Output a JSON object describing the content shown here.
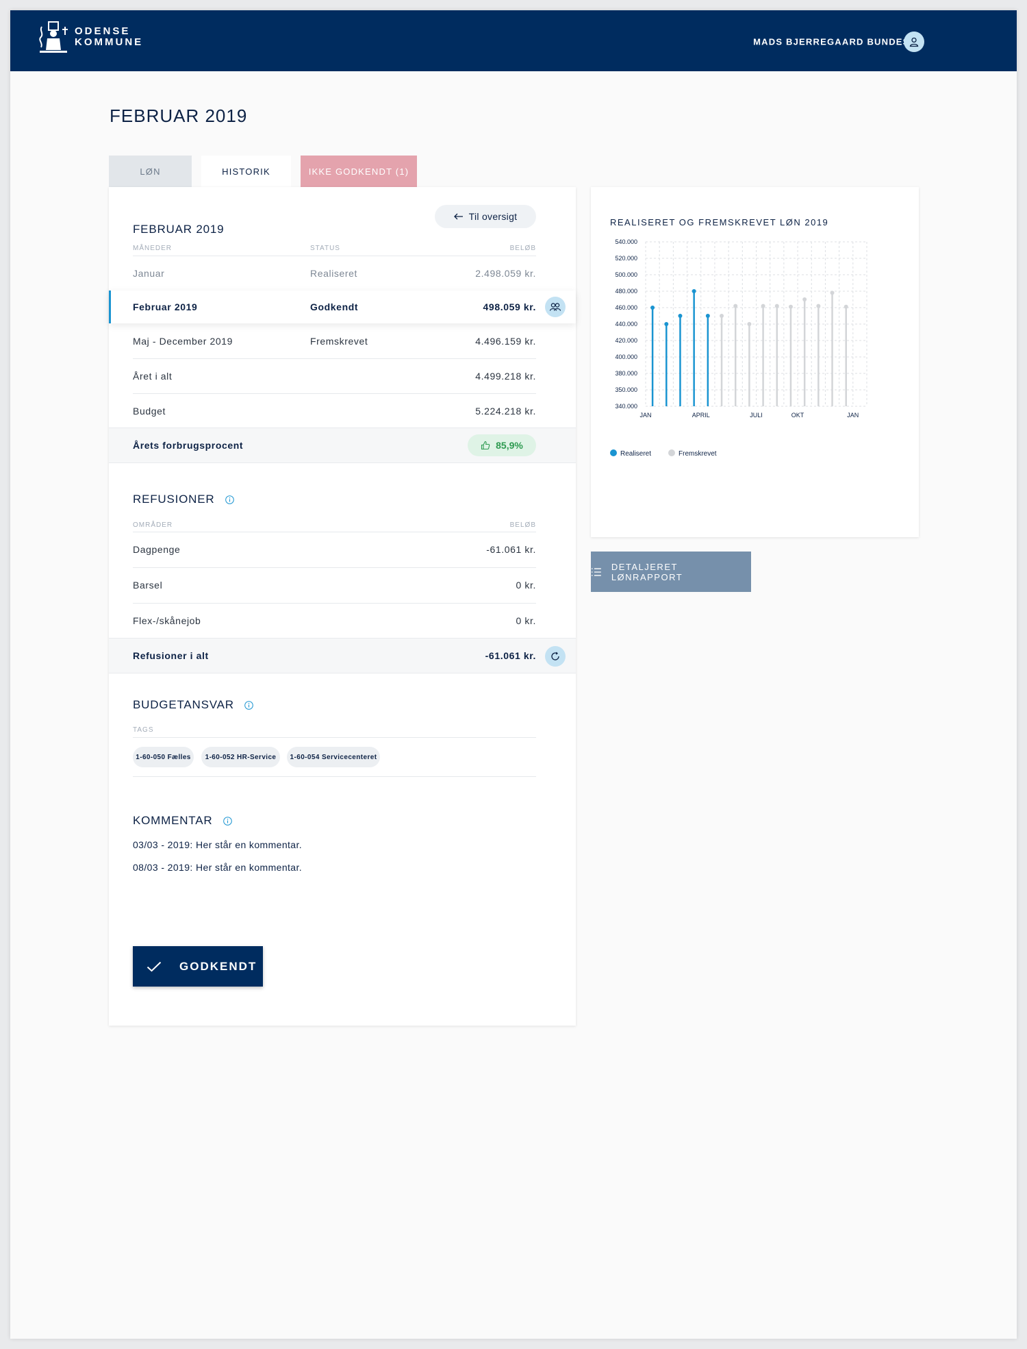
{
  "header": {
    "logo_line1": "ODENSE",
    "logo_line2": "KOMMUNE",
    "user_name": "MADS BJERREGAARD BUNDESEN"
  },
  "page_title": "FEBRUAR 2019",
  "tabs": [
    {
      "label": "LØN"
    },
    {
      "label": "HISTORIK",
      "active": true
    },
    {
      "label": "IKKE GODKENDT (1)"
    }
  ],
  "overview": {
    "title": "FEBRUAR 2019",
    "back_label": "Til oversigt",
    "col_months": "MÅNEDER",
    "col_status": "STATUS",
    "col_amount": "BELØB",
    "rows": [
      {
        "month": "Januar",
        "status": "Realiseret",
        "amount": "2.498.059 kr."
      },
      {
        "month": "Februar 2019",
        "status": "Godkendt",
        "amount": "498.059 kr."
      },
      {
        "month": "Maj - December 2019",
        "status": "Fremskrevet",
        "amount": "4.496.159 kr."
      },
      {
        "month": "Året i alt",
        "status": "",
        "amount": "4.499.218 kr."
      },
      {
        "month": "Budget",
        "status": "",
        "amount": "5.224.218 kr."
      }
    ],
    "usage_label": "Årets forbrugsprocent",
    "usage_value": "85,9%"
  },
  "refusioner": {
    "title": "REFUSIONER",
    "col_areas": "OMRÅDER",
    "col_amount": "BELØB",
    "rows": [
      {
        "label": "Dagpenge",
        "amount": "-61.061 kr."
      },
      {
        "label": "Barsel",
        "amount": "0 kr."
      },
      {
        "label": "Flex-/skånejob",
        "amount": "0 kr."
      }
    ],
    "total_label": "Refusioner i alt",
    "total_amount": "-61.061 kr."
  },
  "budget": {
    "title": "BUDGETANSVAR",
    "col_tags": "TAGS",
    "tags": [
      "1-60-050 Fælles",
      "1-60-052 HR-Service",
      "1-60-054 Servicecenteret"
    ]
  },
  "comments": {
    "title": "KOMMENTAR",
    "items": [
      "03/03 - 2019: Her står en kommentar.",
      "08/03 - 2019: Her står en kommentar."
    ]
  },
  "approve_label": "GODKENDT",
  "report_label": "DETALJERET LØNRAPPORT",
  "colors": {
    "navy": "#002c5f",
    "realiseret": "#1a94d1",
    "fremskrevet": "#d3d5d8",
    "tab_alert": "#e4a3ad",
    "usage_green": "#2d9a50"
  },
  "chart_data": {
    "type": "bar",
    "title": "REALISERET OG FREMSKREVET LØN 2019",
    "y_ticks": [
      "540.000",
      "520.000",
      "500.000",
      "480.000",
      "460.000",
      "440.000",
      "420.000",
      "400.000",
      "380.000",
      "350.000",
      "340.000"
    ],
    "x_tick_labels": [
      "JAN",
      "APRIL",
      "JULI",
      "OKT",
      "JAN"
    ],
    "series": [
      {
        "name": "Realiseret",
        "values": [
          460000,
          440000,
          450000,
          480000,
          450000,
          null,
          null,
          null,
          null,
          null,
          null,
          null,
          null,
          null,
          null
        ]
      },
      {
        "name": "Fremskrevet",
        "values": [
          null,
          null,
          null,
          null,
          null,
          450000,
          462000,
          440000,
          462000,
          462000,
          461000,
          470000,
          462000,
          478000,
          461000
        ]
      }
    ],
    "legend_position": "bottom-left",
    "grid": true
  }
}
